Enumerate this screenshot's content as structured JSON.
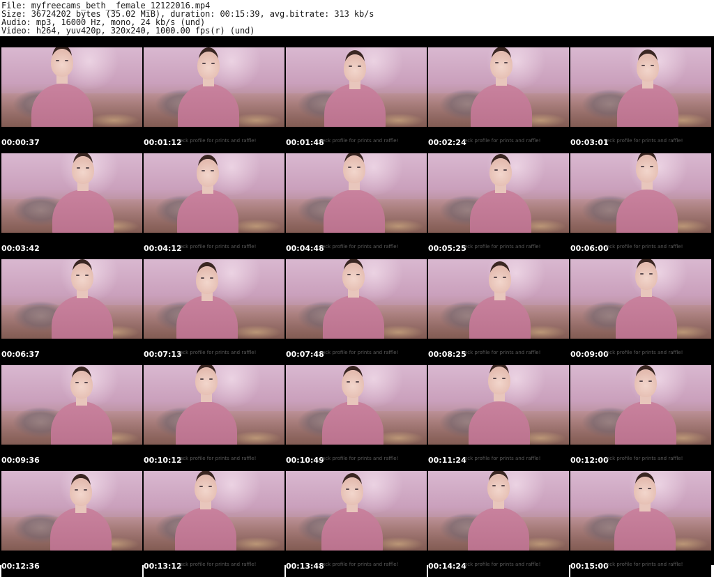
{
  "header": {
    "file_line": "File: myfreecams_beth__female_12122016.mp4",
    "size_line": "Size: 36724202 bytes (35.02 MiB), duration: 00:15:39, avg.bitrate: 313 kb/s",
    "audio_line": "Audio: mp3, 16000 Hz, mono, 24 kb/s (und)",
    "video_line": "Video: h264, yuv420p, 320x240, 1000.00 fps(r) (und)"
  },
  "watermark_text": "eck profile for prints and raffle!",
  "thumbnails": [
    {
      "time": "00:00:37"
    },
    {
      "time": "00:01:12"
    },
    {
      "time": "00:01:48"
    },
    {
      "time": "00:02:24"
    },
    {
      "time": "00:03:01"
    },
    {
      "time": "00:03:42"
    },
    {
      "time": "00:04:12"
    },
    {
      "time": "00:04:48"
    },
    {
      "time": "00:05:25"
    },
    {
      "time": "00:06:00"
    },
    {
      "time": "00:06:37"
    },
    {
      "time": "00:07:13"
    },
    {
      "time": "00:07:48"
    },
    {
      "time": "00:08:25"
    },
    {
      "time": "00:09:00"
    },
    {
      "time": "00:09:36"
    },
    {
      "time": "00:10:12"
    },
    {
      "time": "00:10:49"
    },
    {
      "time": "00:11:24"
    },
    {
      "time": "00:12:00"
    },
    {
      "time": "00:12:36"
    },
    {
      "time": "00:13:12"
    },
    {
      "time": "00:13:48"
    },
    {
      "time": "00:14:24"
    },
    {
      "time": "00:15:00"
    }
  ]
}
